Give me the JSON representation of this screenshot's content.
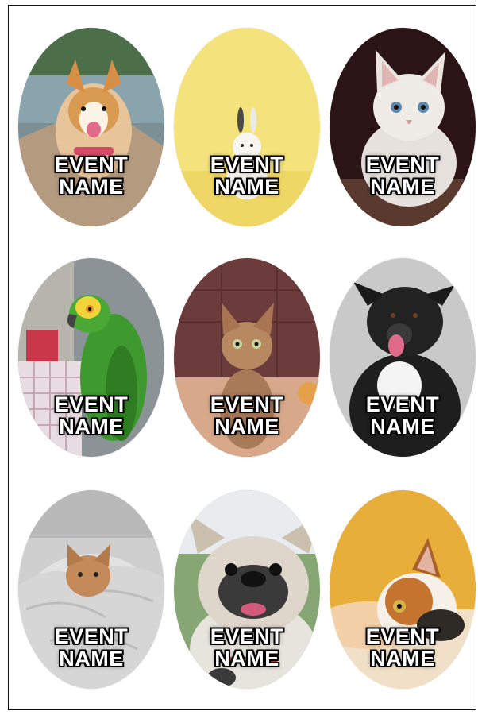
{
  "stickers": [
    {
      "id": "corgi",
      "subject": "corgi-dog",
      "line1": "EVENT",
      "line2": "NAME",
      "bg": "#6b7f86"
    },
    {
      "id": "bunny",
      "subject": "white-bunny",
      "line1": "EVENT",
      "line2": "NAME",
      "bg": "#f2e27a"
    },
    {
      "id": "white-kitten",
      "subject": "white-kitten",
      "line1": "EVENT",
      "line2": "NAME",
      "bg": "#3a1a1c"
    },
    {
      "id": "parrot",
      "subject": "green-parrot",
      "line1": "EVENT",
      "line2": "NAME",
      "bg": "#9aa6a9"
    },
    {
      "id": "tabby-kitten",
      "subject": "tabby-kitten",
      "line1": "EVENT",
      "line2": "NAME",
      "bg": "#6a3b39"
    },
    {
      "id": "border-collie",
      "subject": "black-white-dog",
      "line1": "EVENT",
      "line2": "NAME",
      "bg": "#c8c8c8"
    },
    {
      "id": "blanket-cat",
      "subject": "orange-cat-in-blanket",
      "line1": "EVENT",
      "line2": "NAME",
      "bg": "#d9d9d9"
    },
    {
      "id": "bulldog",
      "subject": "french-bulldog",
      "line1": "EVENT",
      "line2": "NAME",
      "bg": "#7aa06a"
    },
    {
      "id": "calico-cat",
      "subject": "calico-cat",
      "line1": "EVENT",
      "line2": "NAME",
      "bg": "#e8b038"
    }
  ]
}
